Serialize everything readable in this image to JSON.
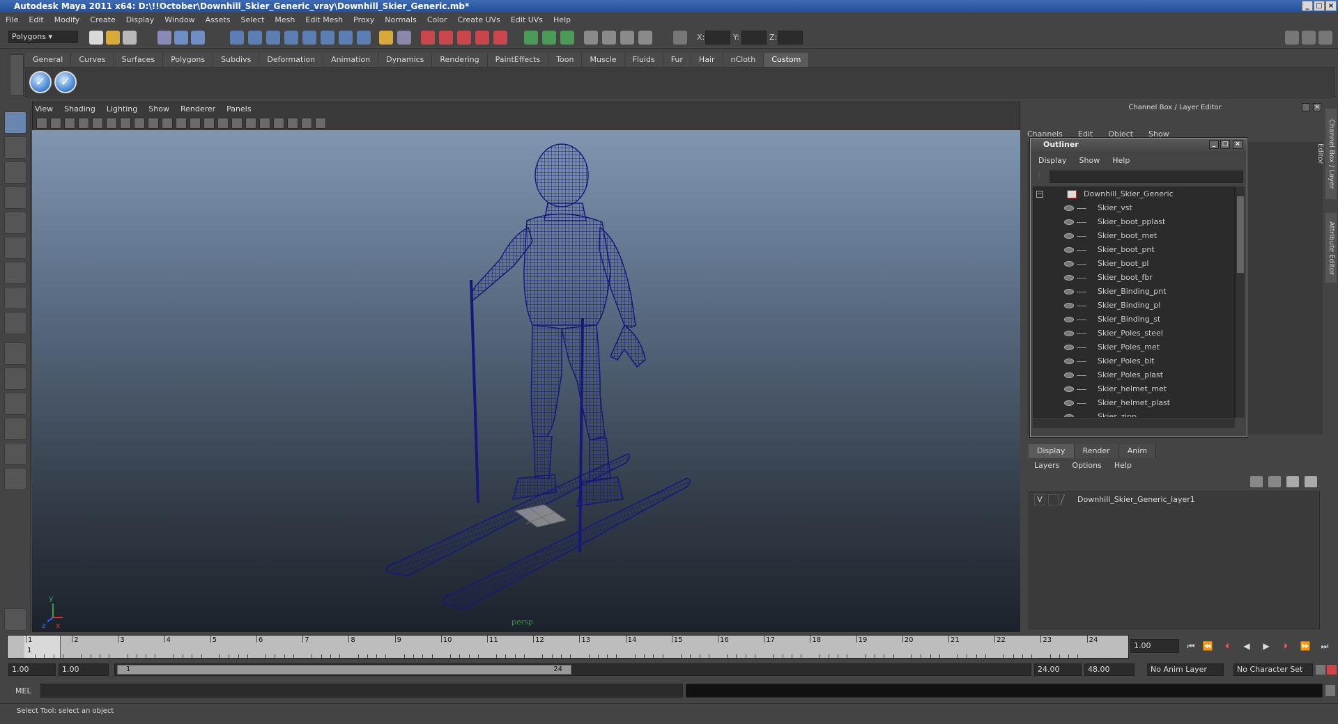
{
  "window": {
    "title": "Autodesk Maya 2011 x64: D:\\!!October\\Downhill_Skier_Generic_vray\\Downhill_Skier_Generic.mb*"
  },
  "menubar": [
    "File",
    "Edit",
    "Modify",
    "Create",
    "Display",
    "Window",
    "Assets",
    "Select",
    "Mesh",
    "Edit Mesh",
    "Proxy",
    "Normals",
    "Color",
    "Create UVs",
    "Edit UVs",
    "Help"
  ],
  "statusline": {
    "mode": "Polygons",
    "x_label": "X:",
    "y_label": "Y:",
    "z_label": "Z:"
  },
  "shelf_tabs": [
    "General",
    "Curves",
    "Surfaces",
    "Polygons",
    "Subdivs",
    "Deformation",
    "Animation",
    "Dynamics",
    "Rendering",
    "PaintEffects",
    "Toon",
    "Muscle",
    "Fluids",
    "Fur",
    "Hair",
    "nCloth",
    "Custom"
  ],
  "active_shelf_tab": "Custom",
  "viewport": {
    "menu": [
      "View",
      "Shading",
      "Lighting",
      "Show",
      "Renderer",
      "Panels"
    ],
    "camera_label": "persp",
    "axis_y": "y",
    "axis_x": "x",
    "axis_z": "z"
  },
  "channel_box": {
    "header": "Channel Box / Layer Editor",
    "menu": [
      "Channels",
      "Edit",
      "Object",
      "Show"
    ]
  },
  "outliner": {
    "title": "Outliner",
    "menu": [
      "Display",
      "Show",
      "Help"
    ],
    "root": "Downhill_Skier_Generic",
    "items": [
      "Skier_vst",
      "Skier_boot_pplast",
      "Skier_boot_met",
      "Skier_boot_pnt",
      "Skier_boot_pl",
      "Skier_boot_fbr",
      "Skier_Binding_pnt",
      "Skier_Binding_pl",
      "Skier_Binding_st",
      "Skier_Poles_steel",
      "Skier_Poles_met",
      "Skier_Poles_blt",
      "Skier_Poles_plast",
      "Skier_helmet_met",
      "Skier_helmet_plast",
      "Skier_zipp"
    ]
  },
  "layer_editor": {
    "tabs": [
      "Display",
      "Render",
      "Anim"
    ],
    "active_tab": "Display",
    "menu": [
      "Layers",
      "Options",
      "Help"
    ],
    "layer_visibility": "V",
    "layer_name": "Downhill_Skier_Generic_layer1"
  },
  "side_tabs": [
    "Channel Box / Layer Editor",
    "Attribute Editor"
  ],
  "timeline": {
    "ticks": [
      "1",
      "2",
      "3",
      "4",
      "5",
      "6",
      "7",
      "8",
      "9",
      "10",
      "11",
      "12",
      "13",
      "14",
      "15",
      "16",
      "17",
      "18",
      "19",
      "20",
      "21",
      "22",
      "23",
      "24"
    ],
    "current_frame": "1.00",
    "current_marker": "1"
  },
  "range": {
    "start": "1.00",
    "playback_start": "1.00",
    "slider_start": "1",
    "slider_end": "24",
    "playback_end": "24.00",
    "end": "48.00",
    "anim_layer": "No Anim Layer",
    "character_set": "No Character Set"
  },
  "command_line": {
    "label": "MEL"
  },
  "help_line": {
    "text": "Select Tool: select an object"
  },
  "colors": {
    "wireframe": "#141a7a",
    "accent": "#3d6bb5"
  }
}
